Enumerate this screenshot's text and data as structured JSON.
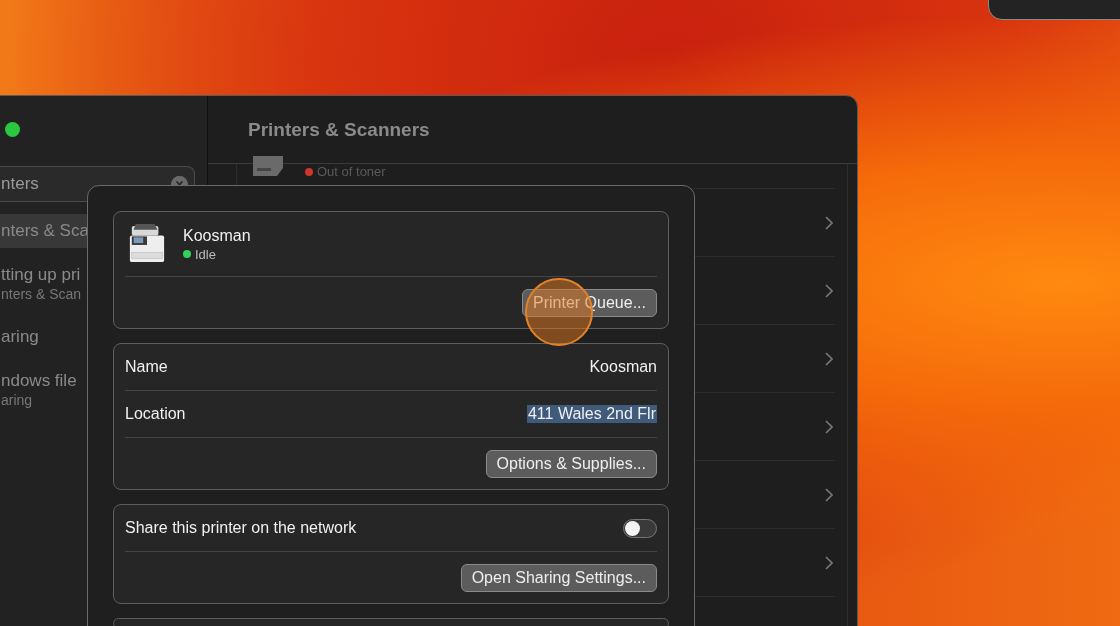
{
  "main_window": {
    "title": "Printers & Scanners",
    "search": {
      "value": "nters"
    },
    "sidebar_items": [
      {
        "title": "nters & Sca",
        "selected": true
      },
      {
        "title": "tting up pri",
        "subtitle": "nters & Scan",
        "selected": false
      },
      {
        "title": "aring",
        "selected": false
      },
      {
        "title": "ndows file",
        "subtitle": "aring",
        "selected": false
      }
    ],
    "printer_list": [
      {
        "status": "Out of toner",
        "color": "#d0342c"
      }
    ]
  },
  "sheet": {
    "printer": {
      "name": "Koosman",
      "status": "Idle",
      "color": "#30d158"
    },
    "queue_button": "Printer Queue...",
    "info_rows": [
      {
        "label": "Name",
        "value": "Koosman",
        "selected": false
      },
      {
        "label": "Location",
        "value": "411 Wales 2nd Flr",
        "selected": true
      }
    ],
    "options_button": "Options & Supplies...",
    "share": {
      "label": "Share this printer on the network",
      "on": false
    },
    "sharing_button": "Open Sharing Settings..."
  }
}
